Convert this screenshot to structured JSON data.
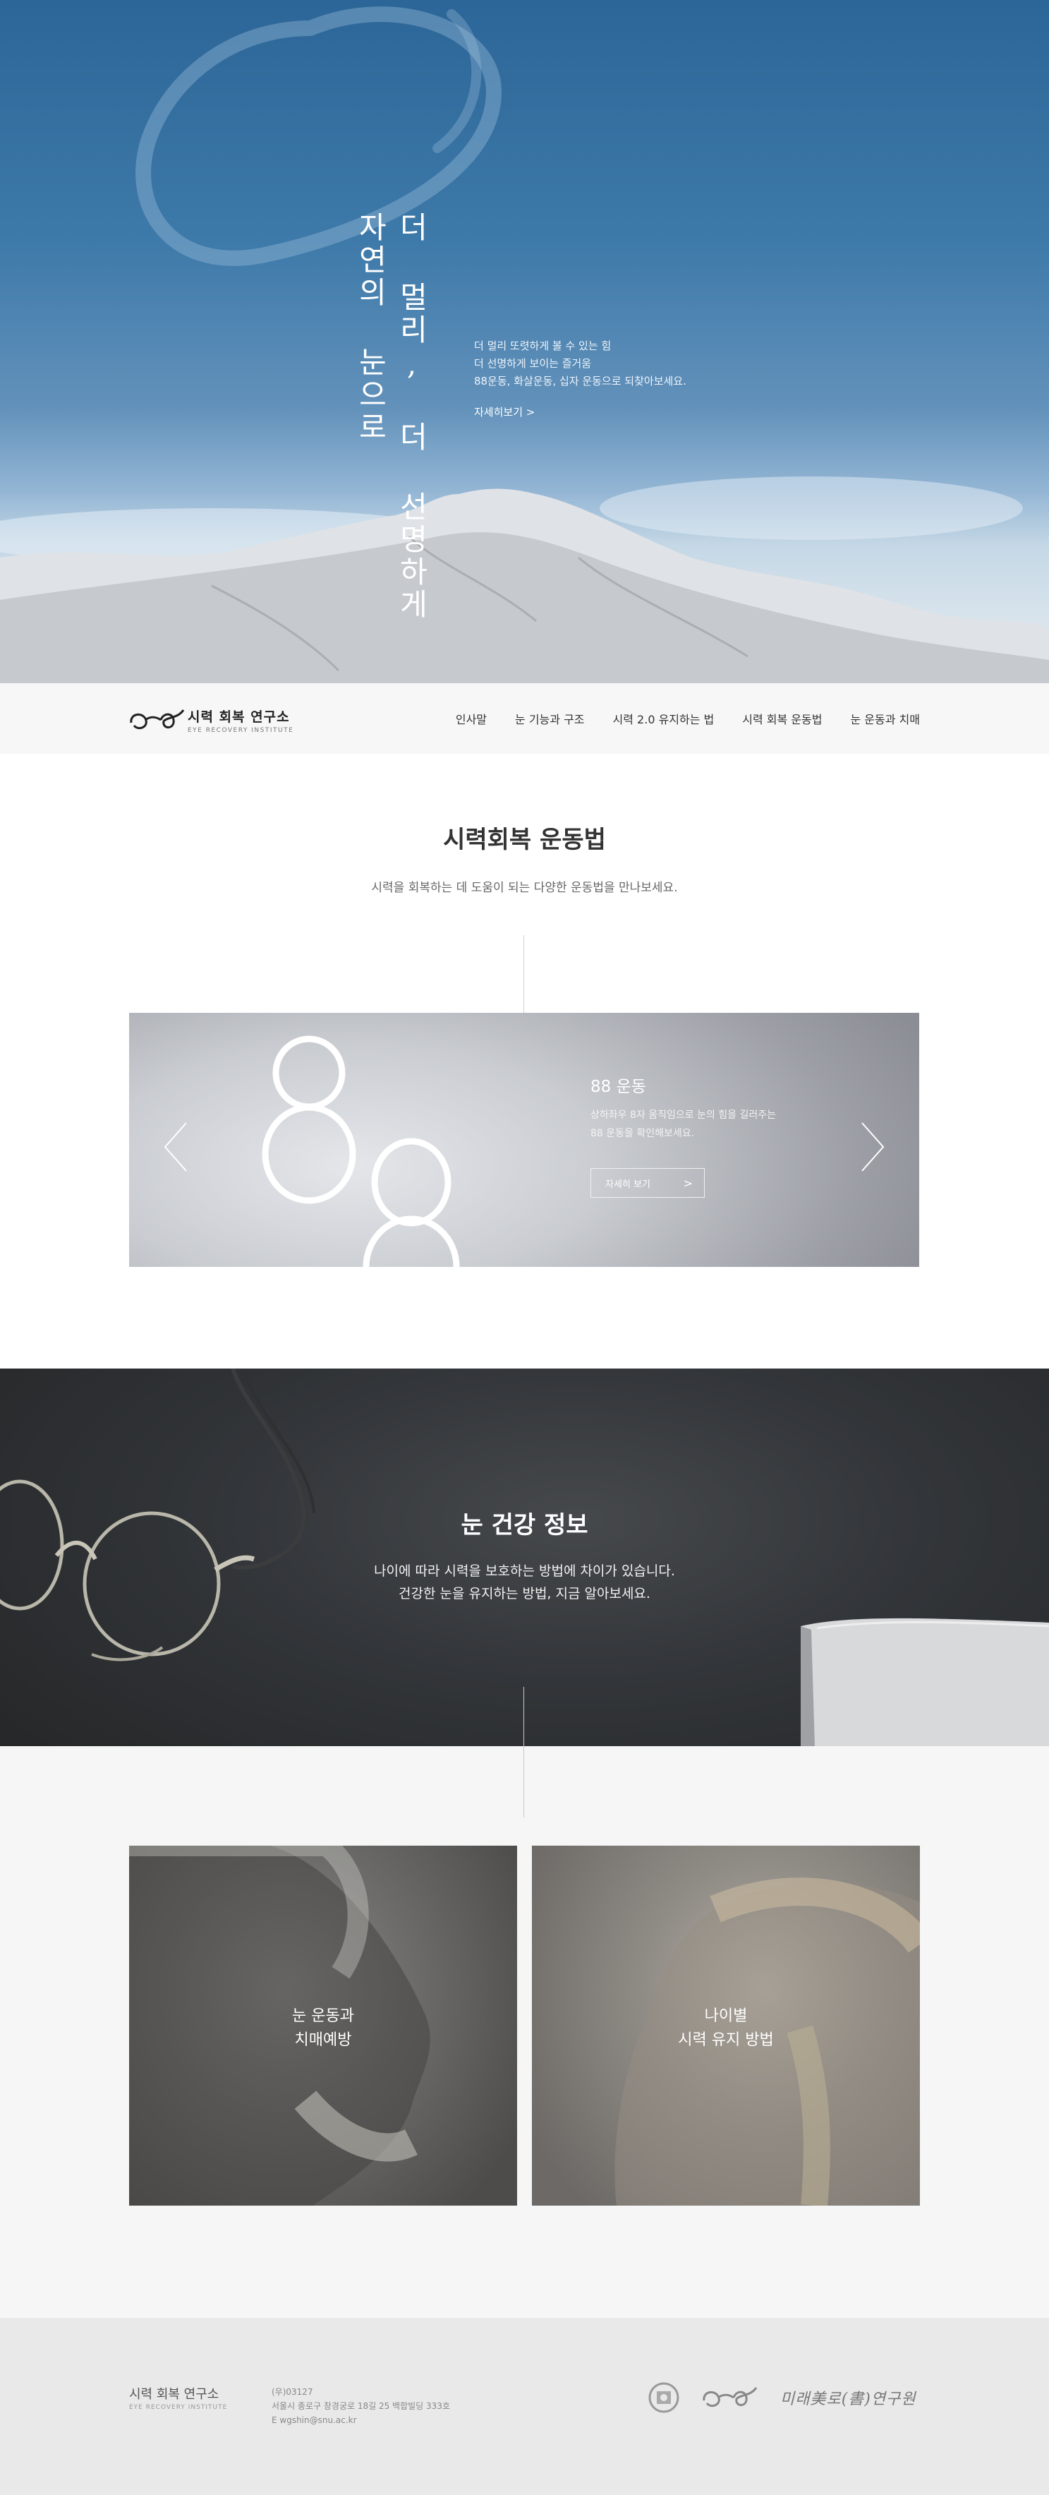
{
  "hero": {
    "vertical_line_1": "자연의 눈으로",
    "vertical_line_2": "더 멀리, 더 선명하게",
    "desc_line_1": "더 멀리 또렷하게 볼 수 있는 힘",
    "desc_line_2": "더 선명하게 보이는 즐거움",
    "desc_line_3": "88운동, 화살운동, 십자 운동으로 되찾아보세요.",
    "more_link": "자세히보기 >"
  },
  "nav": {
    "logo_ko": "시력 회복 연구소",
    "logo_en": "EYE RECOVERY INSTITUTE",
    "menu": [
      "인사말",
      "눈 기능과 구조",
      "시력 2.0 유지하는 법",
      "시력 회복 운동법",
      "눈 운동과 치매"
    ]
  },
  "exercise": {
    "title": "시력회복 운동법",
    "subtitle": "시력을 회복하는 데 도움이 되는 다양한 운동법을 만나보세요.",
    "slide": {
      "title": "88 운동",
      "desc_line_1": "상하좌우 8자 움직임으로 눈의 힘을 길러주는",
      "desc_line_2": "88 운동을 확인해보세요.",
      "button": "자세히 보기",
      "button_chevron": ">"
    }
  },
  "health": {
    "title": "눈 건강 정보",
    "desc_line_1": "나이에 따라 시력을 보호하는 방법에 차이가 있습니다.",
    "desc_line_2": "건강한 눈을 유지하는 방법, 지금 알아보세요."
  },
  "cards": [
    {
      "line_1": "눈 운동과",
      "line_2": "치매예방"
    },
    {
      "line_1": "나이별",
      "line_2": "시력 유지 방법"
    }
  ],
  "footer": {
    "name": "시력 회복 연구소",
    "name_en": "EYE RECOVERY INSTITUTE",
    "postal": "(우)03127",
    "address": "서울시 종로구 창경궁로 18길 25 백합빌딩 333호",
    "email": "E wgshin@snu.ac.kr",
    "calligraphy": "미래美로(書)연구원"
  },
  "colors": {
    "sky_top": "#2c6698",
    "nav_bg": "#f7f7f7",
    "health_bg": "#33363a",
    "footer_bg": "#e8e9e8"
  },
  "icons": [
    "logo-glasses-icon",
    "prev-arrow-icon",
    "next-arrow-icon",
    "chevron-right-icon",
    "university-seal-icon"
  ]
}
